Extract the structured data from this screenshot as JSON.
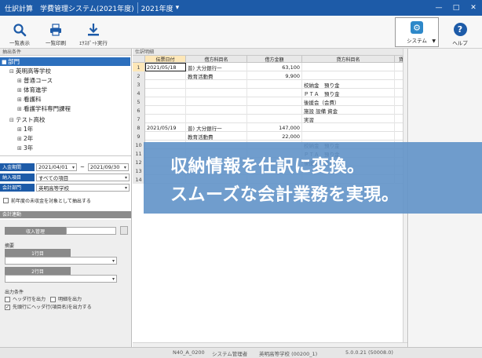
{
  "titlebar": {
    "app_title": "仕訳計算　学費管理システム(2021年度)",
    "year_label": "2021年度",
    "window_controls": [
      "—",
      "□",
      "✕"
    ]
  },
  "ribbon": {
    "buttons": [
      {
        "label": "一覧表示",
        "icon": "search-icon"
      },
      {
        "label": "一覧印刷",
        "icon": "printer-icon"
      },
      {
        "label": "ｴｸｽﾎﾟｰﾄ実行",
        "icon": "export-icon"
      }
    ],
    "system_label": "システム",
    "help_label": "ヘルプ"
  },
  "left_panel": {
    "header": "抽出条件",
    "tree": [
      {
        "label": "部門",
        "toggle": "■",
        "level": 0,
        "selected": true
      },
      {
        "label": "英明高等学校",
        "toggle": "⊟",
        "level": 1
      },
      {
        "label": "普通コース",
        "toggle": "⊞",
        "level": 2
      },
      {
        "label": "体育進学",
        "toggle": "⊞",
        "level": 2
      },
      {
        "label": "看護科",
        "toggle": "⊞",
        "level": 2
      },
      {
        "label": "看護学科専門課程",
        "toggle": "⊞",
        "level": 2
      },
      {
        "label": "テスト高校",
        "toggle": "⊟",
        "level": 1
      },
      {
        "label": "1年",
        "toggle": "⊞",
        "level": 2
      },
      {
        "label": "2年",
        "toggle": "⊞",
        "level": 2
      },
      {
        "label": "3年",
        "toggle": "⊞",
        "level": 2
      }
    ],
    "filters": {
      "period_label": "入金期間",
      "period_from": "2021/04/01",
      "period_tilde": "~",
      "period_to": "2021/09/30",
      "item_label": "納入項目",
      "item_value": "すべての項目",
      "dept_label": "会計部門",
      "dept_value": "英明高等学校",
      "prev_year_label": "前年度の未収金を対象として抽出する"
    },
    "accounting": {
      "header": "会計連動",
      "file_label": "収入管理",
      "file_value": "",
      "summary_label": "摘要",
      "line1_label": "1行目",
      "line2_label": "2行目",
      "output_header": "出力条件",
      "opt_header_rows": "ヘッダ行を出力",
      "opt_detail": "明細を出力",
      "opt_first_row": "先頭行にヘッダ行(項目名)を出力する",
      "opt_first_row_checked": "✓"
    }
  },
  "grid": {
    "header": "仕訳明細",
    "columns": [
      "伝票日付",
      "借方科目名",
      "借方金額",
      "貸方科目名",
      "貸"
    ],
    "rows": [
      {
        "no": "1",
        "date": "2021/05/18",
        "debit": "普) 大分銀行一",
        "amount": "63,100",
        "credit": ""
      },
      {
        "no": "2",
        "date": "",
        "debit": "教育活動費",
        "amount": "9,900",
        "credit": ""
      },
      {
        "no": "3",
        "date": "",
        "debit": "",
        "amount": "",
        "credit": "校納金　預り金"
      },
      {
        "no": "4",
        "date": "",
        "debit": "",
        "amount": "",
        "credit": "ＰＴＡ　預り金"
      },
      {
        "no": "5",
        "date": "",
        "debit": "",
        "amount": "",
        "credit": "後援会（会費）"
      },
      {
        "no": "6",
        "date": "",
        "debit": "",
        "amount": "",
        "credit": "施設 設備 資金"
      },
      {
        "no": "7",
        "date": "",
        "debit": "",
        "amount": "",
        "credit": "実習"
      },
      {
        "no": "8",
        "date": "2021/05/19",
        "debit": "普) 大分銀行一",
        "amount": "147,000",
        "credit": ""
      },
      {
        "no": "9",
        "date": "",
        "debit": "教育活動費",
        "amount": "22,000",
        "credit": ""
      },
      {
        "no": "10",
        "date": "",
        "debit": "",
        "amount": "",
        "credit": "校納金　預り金"
      },
      {
        "no": "11",
        "date": "",
        "debit": "",
        "amount": "",
        "credit": "ＰＴＡ　預り金"
      },
      {
        "no": "12",
        "date": "",
        "debit": "",
        "amount": "",
        "credit": "後援会（会費）"
      },
      {
        "no": "13",
        "date": "",
        "debit": "",
        "amount": "",
        "credit": ""
      },
      {
        "no": "14",
        "date": "",
        "debit": "",
        "amount": "",
        "credit": ""
      }
    ]
  },
  "overlay": {
    "line1": "収納情報を仕訳に変換。",
    "line2": "スムーズな会計業務を実現。"
  },
  "statusbar": {
    "items": [
      "N40_A_0200",
      "システム管理者",
      "英明高等学校 (00200_1)",
      "5.0.0.21 (50008.0)"
    ]
  },
  "colors": {
    "titlebar": "#1d5ba8",
    "accent": "#2c6fbd",
    "overlay": "#6092c8",
    "active_header": "#fde7b8"
  }
}
